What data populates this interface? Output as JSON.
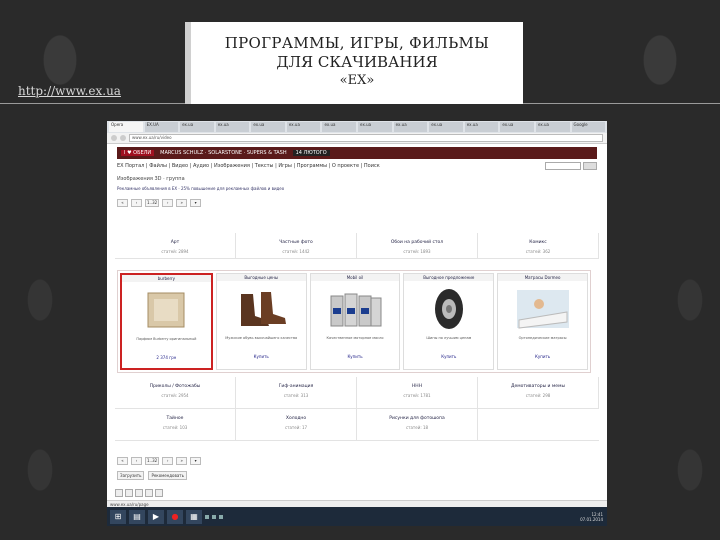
{
  "slide": {
    "url": "http://www.ex.ua",
    "title_line1": "ПРОГРАММЫ, ИГРЫ, ФИЛЬМЫ",
    "title_line2": "ДЛЯ СКАЧИВАНИЯ",
    "title_line3": "«EX»"
  },
  "browser": {
    "tabs": [
      "Opera",
      "EX.UA",
      "ex.ua",
      "ex.ua",
      "ex.ua",
      "ex.ua",
      "ex.ua",
      "ex.ua",
      "ex.ua",
      "ex.ua",
      "ex.ua",
      "ex.ua",
      "ex.ua",
      "Google"
    ],
    "address": "www.ex.ua/ru/video",
    "banner": {
      "heart": "I ♥ ОБЕЛИ",
      "artists": "MARCUS SCHULZ · SOLARSTONE · SUPERS & TASH",
      "date": "14 ЛЮТОГО"
    },
    "menu": "EX Портал | Файлы | Видео | Аудио | Изображения | Тексты | Игры | Программы | О проекте | Поиск",
    "breadcrumb": "Изображения 3D · группа",
    "ad_text": "Рекламные объявления в ЕХ · 25% повышение для рекламных файлов и видео",
    "pager_top": [
      "«",
      "‹",
      "1..32",
      "›",
      "»",
      "▾"
    ],
    "categories_top": [
      {
        "title": "Арт",
        "sub": "статей: 2894"
      },
      {
        "title": "Частные фото",
        "sub": "статей: 1442"
      },
      {
        "title": "Обои на рабочий стол",
        "sub": "статей: 1893"
      },
      {
        "title": "Комикс",
        "sub": "статей: 362"
      }
    ],
    "products": [
      {
        "title": "burberry",
        "desc": "Парфюм Burberry оригинальный",
        "price": "2 374 грн",
        "selected": true
      },
      {
        "title": "Выгодные цены",
        "desc": "Мужские обувь высочайшего качества",
        "price": "Купить",
        "selected": false
      },
      {
        "title": "Mobil oil",
        "desc": "Качественное моторное масло",
        "price": "Купить",
        "selected": false
      },
      {
        "title": "Выгодное предложение",
        "desc": "Шины по лучшим ценам",
        "price": "Купить",
        "selected": false
      },
      {
        "title": "Матрасы Dormeo",
        "desc": "Ортопедические матрасы",
        "price": "Купить",
        "selected": false
      }
    ],
    "categories_bottom": [
      {
        "title": "Приколы / Фотожабы",
        "sub": "статей: 2954"
      },
      {
        "title": "Гиф-анимация",
        "sub": "статей: 313"
      },
      {
        "title": "ННН",
        "sub": "статей: 1781"
      },
      {
        "title": "Демотиваторы и мемы",
        "sub": "статей: 298"
      },
      {
        "title": "Тайное",
        "sub": "статей: 103"
      },
      {
        "title": "Холодно",
        "sub": "статей: 17"
      },
      {
        "title": "Рисунки для фотошопа",
        "sub": "статей: 18"
      },
      {
        "title": "",
        "sub": ""
      }
    ],
    "pager_bottom": [
      "«",
      "‹",
      "1..32",
      "›",
      "»",
      "▾"
    ],
    "bottom_links": [
      "Загрузить",
      "Рекомендовать"
    ],
    "status": "www.ex.ua/ru/page",
    "clock_time": "12:41",
    "clock_date": "07.01.2014"
  }
}
